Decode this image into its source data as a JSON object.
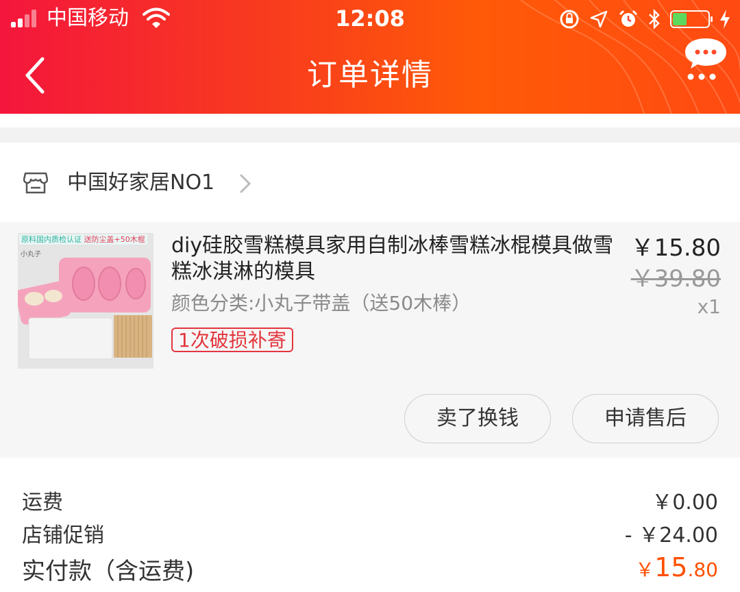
{
  "status_bar": {
    "carrier": "中国移动",
    "time": "12:08"
  },
  "nav": {
    "title": "订单详情",
    "back_icon": "chevron-left-icon",
    "more_icon": "chat-bubble-more-icon"
  },
  "shop": {
    "name": "中国好家居NO1"
  },
  "item": {
    "title": "diy硅胶雪糕模具家用自制冰棒雪糕冰棍模具做雪糕冰淇淋的模具",
    "sku": "颜色分类:小丸子带盖（送50木棒）",
    "tag": "1次破损补寄",
    "price": "￥15.80",
    "original_price": "￥39.80",
    "quantity": "x1",
    "thumbnail_banner": "原料国内质检认证",
    "thumbnail_banner_2": "送防尘盖+50木棍",
    "thumbnail_label": "小丸子"
  },
  "actions": {
    "sell": "卖了换钱",
    "after_sale": "申请售后"
  },
  "fees": {
    "shipping_label": "运费",
    "shipping_value": "￥0.00",
    "promo_label": "店铺促销",
    "promo_value": "- ￥24.00",
    "total_label": "实付款（含运费)",
    "total_currency": "￥",
    "total_int": "15",
    "total_dec": ".80"
  },
  "colors": {
    "header_start": "#f4163c",
    "header_end": "#ff5a08",
    "accent": "#ff5000",
    "tag": "#e2353c"
  }
}
